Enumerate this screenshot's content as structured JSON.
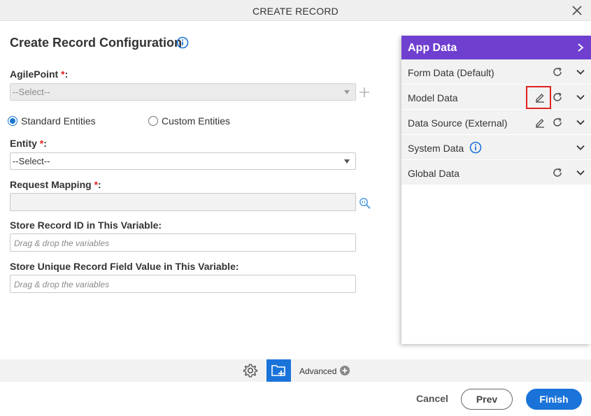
{
  "dialog": {
    "title": "CREATE RECORD"
  },
  "form": {
    "heading": "Create Record Configuration",
    "agilepoint": {
      "label": "AgilePoint",
      "req": "*",
      "suffix": ":",
      "value": "--Select--"
    },
    "radios": [
      {
        "label": "Standard Entities",
        "checked": true
      },
      {
        "label": "Custom Entities",
        "checked": false
      }
    ],
    "entity": {
      "label": "Entity",
      "req": "*",
      "suffix": ":",
      "value": "--Select--"
    },
    "request_mapping": {
      "label": "Request Mapping",
      "req": "*",
      "suffix": ":"
    },
    "store_record_id": {
      "label": "Store Record ID in This Variable:",
      "placeholder": "Drag & drop the variables"
    },
    "store_unique": {
      "label": "Store Unique Record Field Value in This Variable:",
      "placeholder": "Drag & drop the variables"
    }
  },
  "app_data": {
    "title": "App Data",
    "rows": [
      {
        "label": "Form Data (Default)"
      },
      {
        "label": "Model Data"
      },
      {
        "label": "Data Source (External)"
      },
      {
        "label": "System Data"
      },
      {
        "label": "Global Data"
      }
    ]
  },
  "footer": {
    "advanced": "Advanced",
    "cancel": "Cancel",
    "prev": "Prev",
    "finish": "Finish"
  },
  "colors": {
    "accent": "#1a73d9",
    "panel_header": "#6f3fd0",
    "required": "#e0231f"
  }
}
